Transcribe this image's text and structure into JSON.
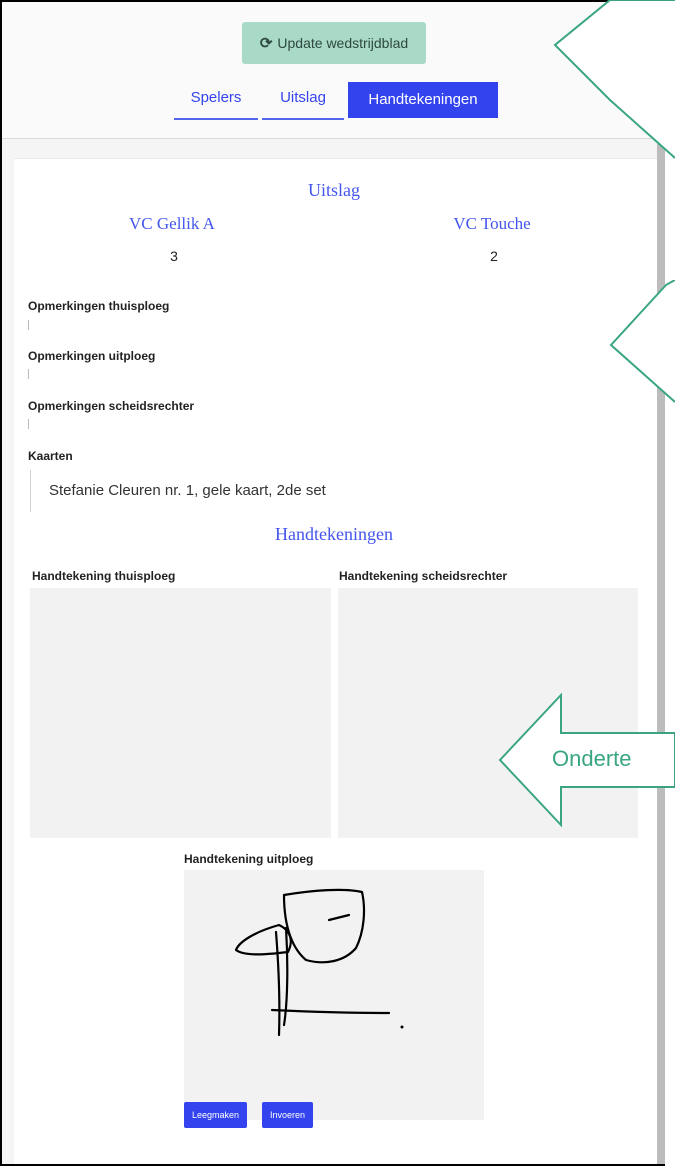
{
  "toolbar": {
    "update_icon": "refresh-icon",
    "update_label": "Update wedstrijdblad"
  },
  "tabs": [
    {
      "label": "Spelers",
      "active": false
    },
    {
      "label": "Uitslag",
      "active": false
    },
    {
      "label": "Handtekeningen",
      "active": true
    }
  ],
  "result": {
    "title": "Uitslag",
    "home_team": "VC Gellik A",
    "away_team": "VC Touche",
    "home_score": "3",
    "away_score": "2"
  },
  "remarks": {
    "home_label": "Opmerkingen thuisploeg",
    "away_label": "Opmerkingen uitploeg",
    "referee_label": "Opmerkingen scheidsrechter",
    "cards_label": "Kaarten",
    "cards_value": "Stefanie Cleuren nr. 1, gele kaart, 2de set"
  },
  "signatures": {
    "title": "Handtekeningen",
    "home_label": "Handtekening thuisploeg",
    "referee_label": "Handtekening scheidsrechter",
    "away_label": "Handtekening uitploeg",
    "clear_button": "Leegmaken",
    "submit_button": "Invoeren"
  },
  "annotation": {
    "arrow_text": "Onderte"
  },
  "colors": {
    "accent": "#3344ee",
    "update_button": "#a9d9c7",
    "callout_stroke": "#3aa680"
  }
}
